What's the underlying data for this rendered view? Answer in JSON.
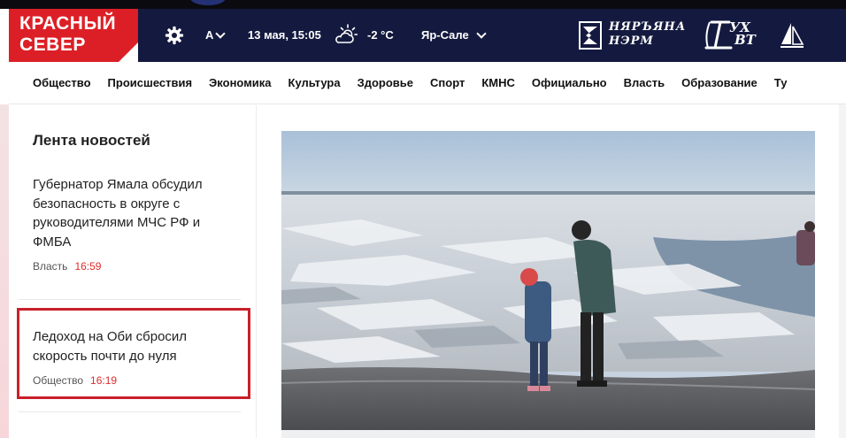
{
  "logo": {
    "line1": "КРАСНЫЙ",
    "line2": "СЕВЕР"
  },
  "header": {
    "font_toggle": "А",
    "datetime": "13 мая, 15:05",
    "temperature": "-2 °C",
    "city": "Яр-Сале",
    "partner1_line1": "НЯРЪЯНА",
    "partner1_line2": "НЭРМ",
    "partner2_line1": "УХ",
    "partner2_line2": "ВТ"
  },
  "nav": {
    "items": [
      "Общество",
      "Происшествия",
      "Экономика",
      "Культура",
      "Здоровье",
      "Спорт",
      "КМНС",
      "Официально",
      "Власть",
      "Образование",
      "Ту"
    ]
  },
  "feed": {
    "title": "Лента новостей",
    "items": [
      {
        "title": "Губернатор Ямала обсудил безопасность в округе с руководителями МЧС РФ и ФМБА",
        "category": "Власть",
        "time": "16:59"
      },
      {
        "title": "Ледоход на Оби сбросил скорость почти до нуля",
        "category": "Общество",
        "time": "16:19"
      }
    ]
  },
  "colors": {
    "brand_red": "#dc1f26",
    "header_navy": "#141a3f",
    "time_red": "#e02b2b",
    "highlight_red": "#c8202a"
  },
  "icons": [
    "gear-icon",
    "chevron-down-icon",
    "weather-partly-cloudy-icon",
    "nyaryana-nerm-logo-icon",
    "sail-icon"
  ]
}
